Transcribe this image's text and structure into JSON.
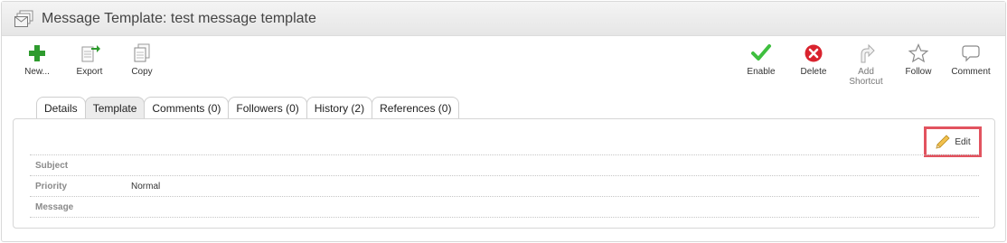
{
  "window": {
    "title": "Message Template: test message template"
  },
  "toolbar": {
    "new_label": "New...",
    "export_label": "Export",
    "copy_label": "Copy",
    "enable_label": "Enable",
    "delete_label": "Delete",
    "add_shortcut_label_1": "Add",
    "add_shortcut_label_2": "Shortcut",
    "follow_label": "Follow",
    "comment_label": "Comment"
  },
  "tabs": [
    {
      "label": "Details"
    },
    {
      "label": "Template",
      "active": true
    },
    {
      "label": "Comments (0)"
    },
    {
      "label": "Followers (0)"
    },
    {
      "label": "History (2)"
    },
    {
      "label": "References (0)"
    }
  ],
  "panel": {
    "edit_label": "Edit",
    "fields": [
      {
        "label": "Subject",
        "value": ""
      },
      {
        "label": "Priority",
        "value": "Normal"
      },
      {
        "label": "Message",
        "value": ""
      }
    ]
  },
  "colors": {
    "new_green": "#2e9b2e",
    "enable_green": "#3fbf3f",
    "delete_red": "#d9232e",
    "highlight": "#e2535f"
  }
}
